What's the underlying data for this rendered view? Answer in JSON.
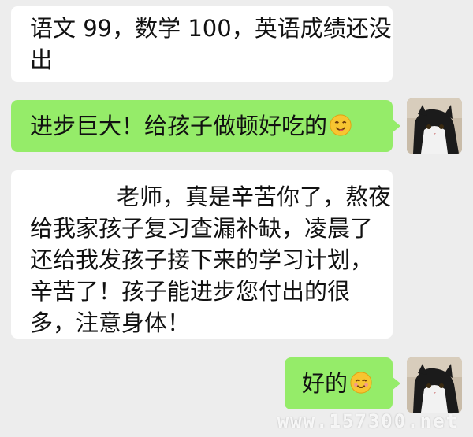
{
  "chat": {
    "messages": [
      {
        "side": "in",
        "lines": [
          "语文 99，数学 100，英语成绩还没",
          "出"
        ]
      },
      {
        "side": "out",
        "text": "进步巨大！给孩子做顿好吃的",
        "emoji": "yum-emoji"
      },
      {
        "side": "in",
        "lines": [
          "老师，真是辛苦你了，熬夜",
          "给我家孩子复习查漏补缺，凌晨了",
          "还给我发孩子接下来的学习计划，",
          "辛苦了！孩子能进步您付出的很",
          "多，注意身体！"
        ]
      },
      {
        "side": "out",
        "text": "好的",
        "emoji": "smile-emoji"
      }
    ]
  },
  "watermark": "www.157300.net",
  "colors": {
    "background": "#ededed",
    "incoming": "#ffffff",
    "outgoing": "#95ec69"
  }
}
